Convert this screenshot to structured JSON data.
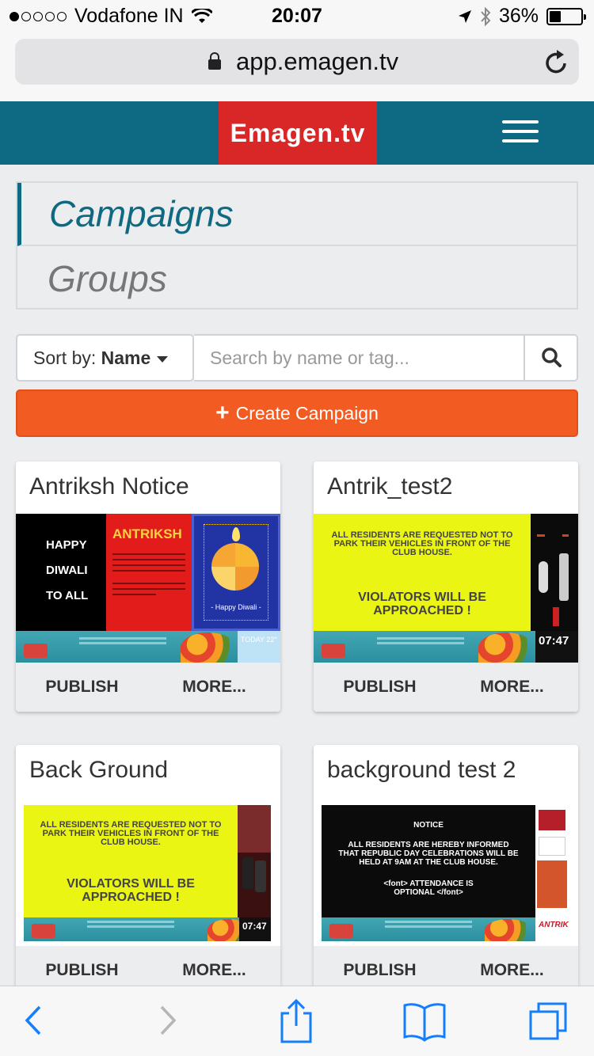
{
  "status_bar": {
    "carrier": "Vodafone IN",
    "time": "20:07",
    "battery": "36%",
    "battery_level": 0.36
  },
  "browser": {
    "url": "app.emagen.tv"
  },
  "header": {
    "logo_text": "Emagen.tv"
  },
  "nav": {
    "campaigns": "Campaigns",
    "groups": "Groups"
  },
  "toolbar": {
    "sort_prefix": "Sort by:",
    "sort_value": "Name",
    "search_placeholder": "Search by name or tag...",
    "create_label": "Create Campaign"
  },
  "cards": [
    {
      "title": "Antriksh Notice",
      "publish": "PUBLISH",
      "more": "MORE...",
      "thumb": {
        "happy_lines": [
          "HAPPY",
          "DIWALI",
          "TO ALL"
        ],
        "brand": "ANTRIKSH",
        "greeting": "- Happy Diwali -",
        "weather": "TODAY 22°"
      }
    },
    {
      "title": "Antrik_test2",
      "publish": "PUBLISH",
      "more": "MORE...",
      "thumb": {
        "notice_small": "ALL RESIDENTS ARE REQUESTED NOT TO PARK THEIR VEHICLES IN FRONT OF THE CLUB HOUSE.",
        "notice_big": "VIOLATORS WILL BE APPROACHED !",
        "clock": "07:47"
      }
    },
    {
      "title": "Back Ground",
      "publish": "PUBLISH",
      "more": "MORE...",
      "thumb": {
        "notice_small": "ALL RESIDENTS ARE REQUESTED NOT TO PARK THEIR VEHICLES IN FRONT OF THE CLUB HOUSE.",
        "notice_big": "VIOLATORS WILL BE APPROACHED !",
        "clock": "07:47"
      }
    },
    {
      "title": "background test 2",
      "publish": "PUBLISH",
      "more": "MORE...",
      "thumb": {
        "heading": "NOTICE",
        "body": "ALL RESIDENTS ARE HEREBY INFORMED THAT REPUBLIC DAY CELEBRATIONS WILL BE HELD AT 9AM AT THE CLUB HOUSE.",
        "footer": "<font> ATTENDANCE IS OPTIONAL </font>",
        "brand": "ANTRIKSH"
      }
    }
  ],
  "colors": {
    "header": "#0e6a83",
    "logo_bg": "#d92727",
    "create_button": "#f25c23",
    "ios_blue": "#157efb"
  }
}
